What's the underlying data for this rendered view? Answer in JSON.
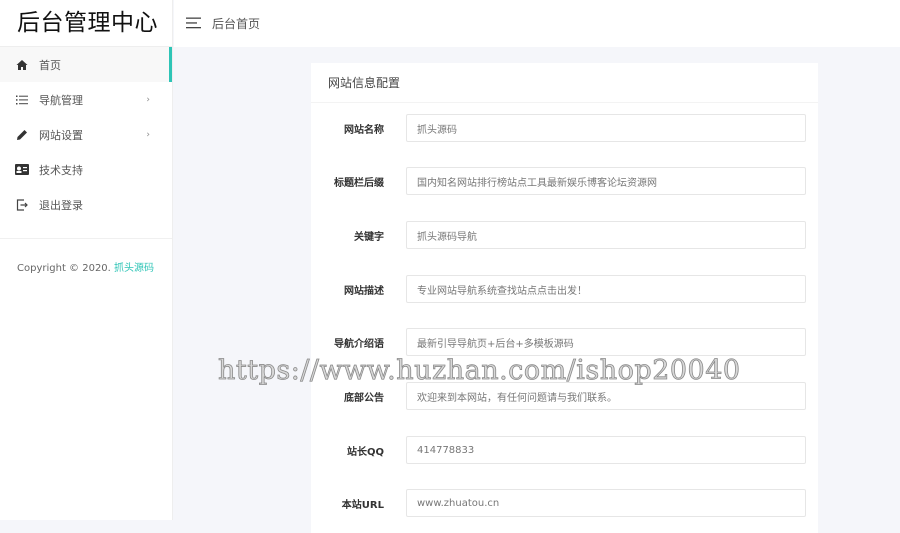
{
  "app": {
    "title": "后台管理中心"
  },
  "header": {
    "breadcrumb": "后台首页"
  },
  "sidebar": {
    "items": [
      {
        "label": "首页",
        "icon": "home-icon",
        "active": true
      },
      {
        "label": "导航管理",
        "icon": "list-icon",
        "chevron": true
      },
      {
        "label": "网站设置",
        "icon": "pencil-icon",
        "chevron": true
      },
      {
        "label": "技术支持",
        "icon": "id-card-icon"
      },
      {
        "label": "退出登录",
        "icon": "logout-icon"
      }
    ],
    "copyright_prefix": "Copyright © 2020. ",
    "copyright_link": "抓头源码"
  },
  "form": {
    "title": "网站信息配置",
    "fields": [
      {
        "label": "网站名称",
        "value": "抓头源码"
      },
      {
        "label": "标题栏后缀",
        "value": "国内知名网站排行榜站点工具最新娱乐博客论坛资源网"
      },
      {
        "label": "关键字",
        "value": "抓头源码导航"
      },
      {
        "label": "网站描述",
        "value": "专业网站导航系统查找站点点击出发！"
      },
      {
        "label": "导航介绍语",
        "value": "最新引导导航页+后台+多模板源码"
      },
      {
        "label": "底部公告",
        "value": "欢迎来到本网站，有任何问题请与我们联系。"
      },
      {
        "label": "站长QQ",
        "value": "414778833"
      },
      {
        "label": "本站URL",
        "value": "www.zhuatou.cn"
      }
    ]
  },
  "watermark": "https://www.huzhan.com/ishop20040",
  "colors": {
    "accent": "#2ec4b6",
    "background": "#f5f6fa"
  }
}
